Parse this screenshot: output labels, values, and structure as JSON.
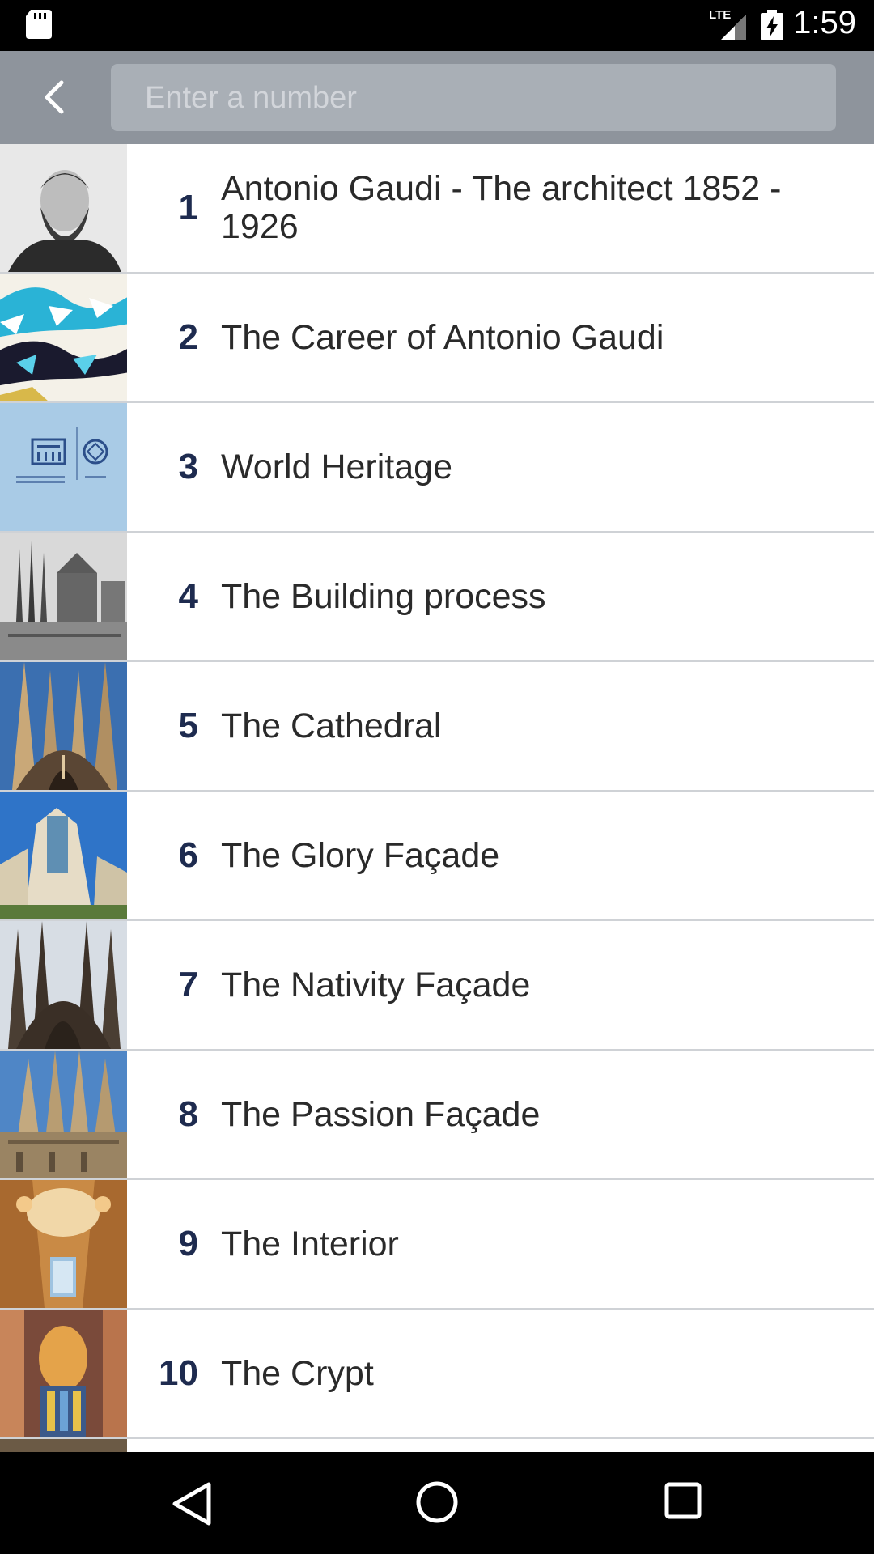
{
  "status_bar": {
    "network_label": "LTE",
    "time": "1:59"
  },
  "app_bar": {
    "search_placeholder": "Enter a number"
  },
  "list": {
    "items": [
      {
        "number": "1",
        "title": "Antonio Gaudi - The architect 1852 - 1926",
        "thumb": "portrait"
      },
      {
        "number": "2",
        "title": "The Career of Antonio Gaudi",
        "thumb": "mosaic"
      },
      {
        "number": "3",
        "title": "World Heritage",
        "thumb": "unesco"
      },
      {
        "number": "4",
        "title": "The Building process",
        "thumb": "historic-photo"
      },
      {
        "number": "5",
        "title": "The Cathedral",
        "thumb": "cathedral"
      },
      {
        "number": "6",
        "title": "The Glory Façade",
        "thumb": "glory-facade"
      },
      {
        "number": "7",
        "title": "The Nativity Façade",
        "thumb": "nativity-facade"
      },
      {
        "number": "8",
        "title": "The Passion Façade",
        "thumb": "passion-facade"
      },
      {
        "number": "9",
        "title": "The Interior",
        "thumb": "interior"
      },
      {
        "number": "10",
        "title": "The Crypt",
        "thumb": "crypt"
      }
    ]
  },
  "colors": {
    "app_bar": "#8e949c",
    "search_box": "#a9afb6",
    "number_text": "#1e2b4f",
    "divider": "#cfd2d6"
  }
}
